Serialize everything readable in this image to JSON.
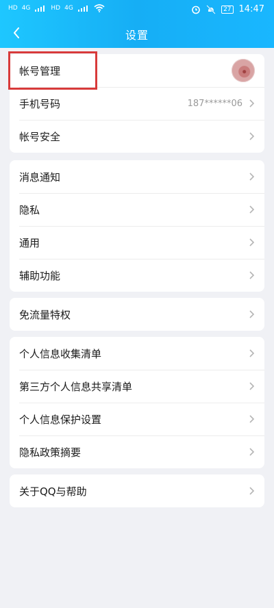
{
  "status_bar": {
    "left_indicators": [
      "HD",
      "4G",
      "HD",
      "4G"
    ],
    "battery": "27",
    "time": "14:47"
  },
  "nav": {
    "title": "设置",
    "back_icon": "chevron-left-icon"
  },
  "groups": [
    {
      "items": [
        {
          "label": "帐号管理",
          "right": "avatar"
        },
        {
          "label": "手机号码",
          "value": "187******06"
        },
        {
          "label": "帐号安全"
        }
      ]
    },
    {
      "items": [
        {
          "label": "消息通知"
        },
        {
          "label": "隐私"
        },
        {
          "label": "通用"
        },
        {
          "label": "辅助功能"
        }
      ]
    },
    {
      "items": [
        {
          "label": "免流量特权"
        }
      ]
    },
    {
      "items": [
        {
          "label": "个人信息收集清单"
        },
        {
          "label": "第三方个人信息共享清单"
        },
        {
          "label": "个人信息保护设置"
        },
        {
          "label": "隐私政策摘要"
        }
      ]
    },
    {
      "items": [
        {
          "label": "关于QQ与帮助"
        }
      ]
    }
  ],
  "colors": {
    "header": "#16aef5",
    "background": "#f0f1f5",
    "highlight": "#d83a3a"
  }
}
